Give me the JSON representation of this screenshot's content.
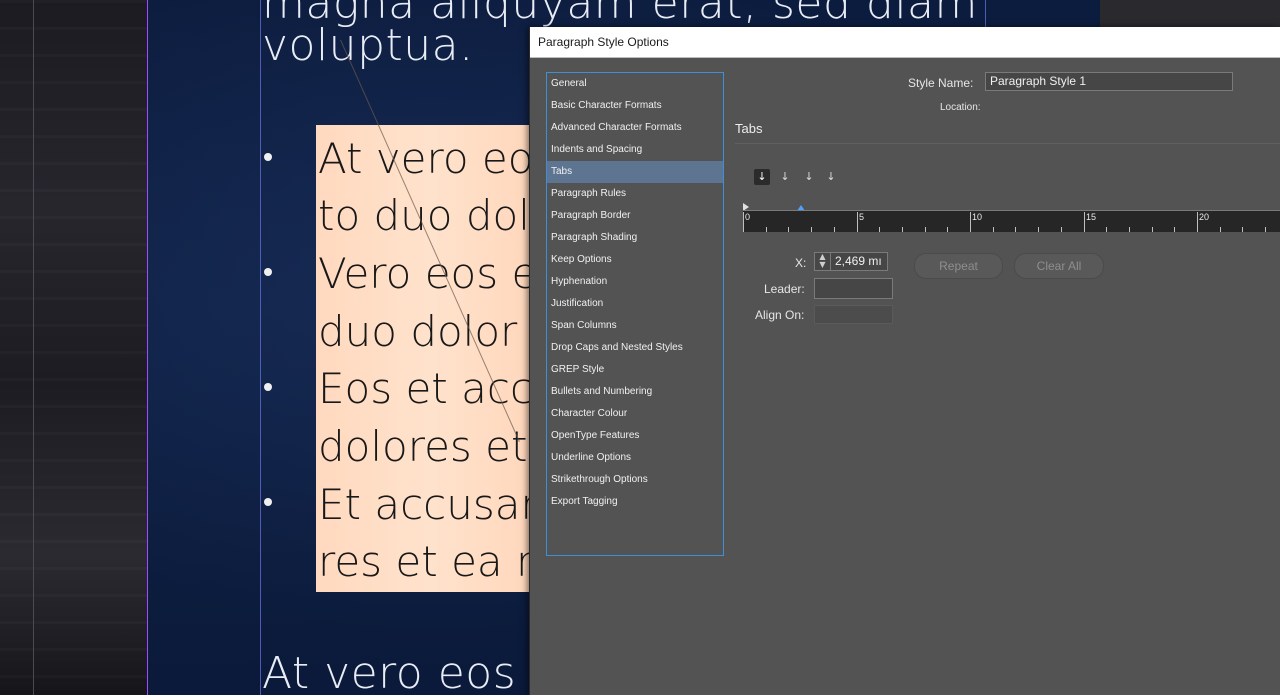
{
  "document": {
    "heading_fragment": "magna aliquyam erat, sed diam",
    "heading_line2": "voluptua.",
    "list_items": [
      {
        "line1": "At vero eos",
        "line2": "to duo dolo"
      },
      {
        "line1": "Vero eos et",
        "line2": "duo dolor"
      },
      {
        "line1": "Eos et acc",
        "line2": "dolores et"
      },
      {
        "line1": "Et accusar",
        "line2": "res et ea r"
      }
    ],
    "footer_text": "At vero eos e"
  },
  "dialog": {
    "title": "Paragraph Style Options",
    "sidebar": {
      "items": [
        {
          "label": "General"
        },
        {
          "label": "Basic Character Formats"
        },
        {
          "label": "Advanced Character Formats"
        },
        {
          "label": "Indents and Spacing"
        },
        {
          "label": "Tabs",
          "selected": true
        },
        {
          "label": "Paragraph Rules"
        },
        {
          "label": "Paragraph Border"
        },
        {
          "label": "Paragraph Shading"
        },
        {
          "label": "Keep Options"
        },
        {
          "label": "Hyphenation"
        },
        {
          "label": "Justification"
        },
        {
          "label": "Span Columns"
        },
        {
          "label": "Drop Caps and Nested Styles"
        },
        {
          "label": "GREP Style"
        },
        {
          "label": "Bullets and Numbering"
        },
        {
          "label": "Character Colour"
        },
        {
          "label": "OpenType Features"
        },
        {
          "label": "Underline Options"
        },
        {
          "label": "Strikethrough Options"
        },
        {
          "label": "Export Tagging"
        }
      ]
    },
    "style_name_label": "Style Name:",
    "style_name_value": "Paragraph Style 1",
    "location_label": "Location:",
    "section_title": "Tabs",
    "tab_buttons": [
      {
        "icon": "left-justified-tab-icon",
        "glyph": "↓",
        "active": true
      },
      {
        "icon": "center-justified-tab-icon",
        "glyph": "↓"
      },
      {
        "icon": "right-justified-tab-icon",
        "glyph": "↓"
      },
      {
        "icon": "align-to-decimal-tab-icon",
        "glyph": "↓"
      }
    ],
    "ruler": {
      "labels": [
        "0",
        "5",
        "10",
        "15",
        "20"
      ],
      "tab_stop_x": "2,469 mm"
    },
    "x_label": "X:",
    "x_value": "2,469 mı",
    "leader_label": "Leader:",
    "leader_value": "",
    "align_on_label": "Align On:",
    "align_on_value": "",
    "repeat_label": "Repeat",
    "clear_all_label": "Clear All",
    "colors": {
      "panel_bg": "#535353",
      "selection": "#5d7591",
      "focus_border": "#3e8fd8"
    }
  }
}
